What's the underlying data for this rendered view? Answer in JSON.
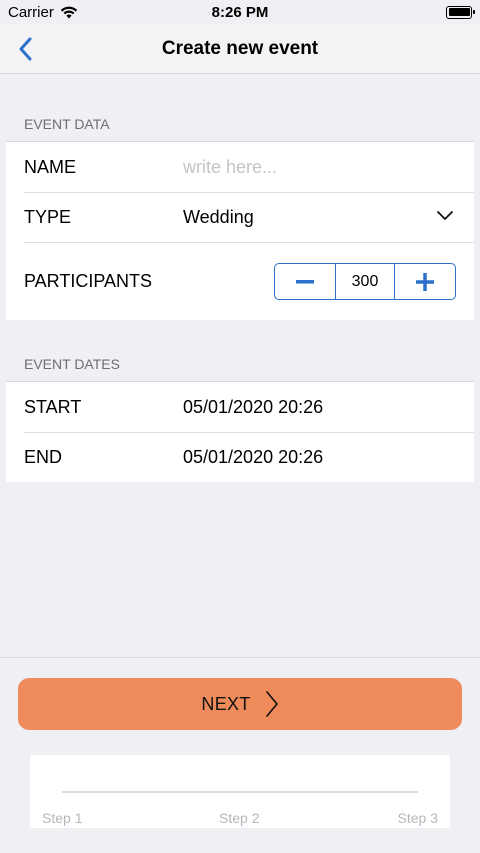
{
  "status_bar": {
    "carrier": "Carrier",
    "time": "8:26 PM"
  },
  "nav": {
    "title": "Create new event",
    "back_icon": "chevron-left-icon"
  },
  "event_data": {
    "header": "EVENT DATA",
    "name": {
      "label": "NAME",
      "placeholder": "write here..."
    },
    "type": {
      "label": "TYPE",
      "value": "Wedding"
    },
    "participants": {
      "label": "PARTICIPANTS",
      "value": "300"
    }
  },
  "event_dates": {
    "header": "EVENT DATES",
    "start": {
      "label": "START",
      "value": "05/01/2020 20:26"
    },
    "end": {
      "label": "END",
      "value": "05/01/2020 20:26"
    }
  },
  "next_button": {
    "label": "NEXT"
  },
  "steps": [
    "Step 1",
    "Step 2",
    "Step 3"
  ],
  "colors": {
    "accent": "#2b70c9",
    "next_bg": "#ef8b5b",
    "background": "#efeff4"
  }
}
